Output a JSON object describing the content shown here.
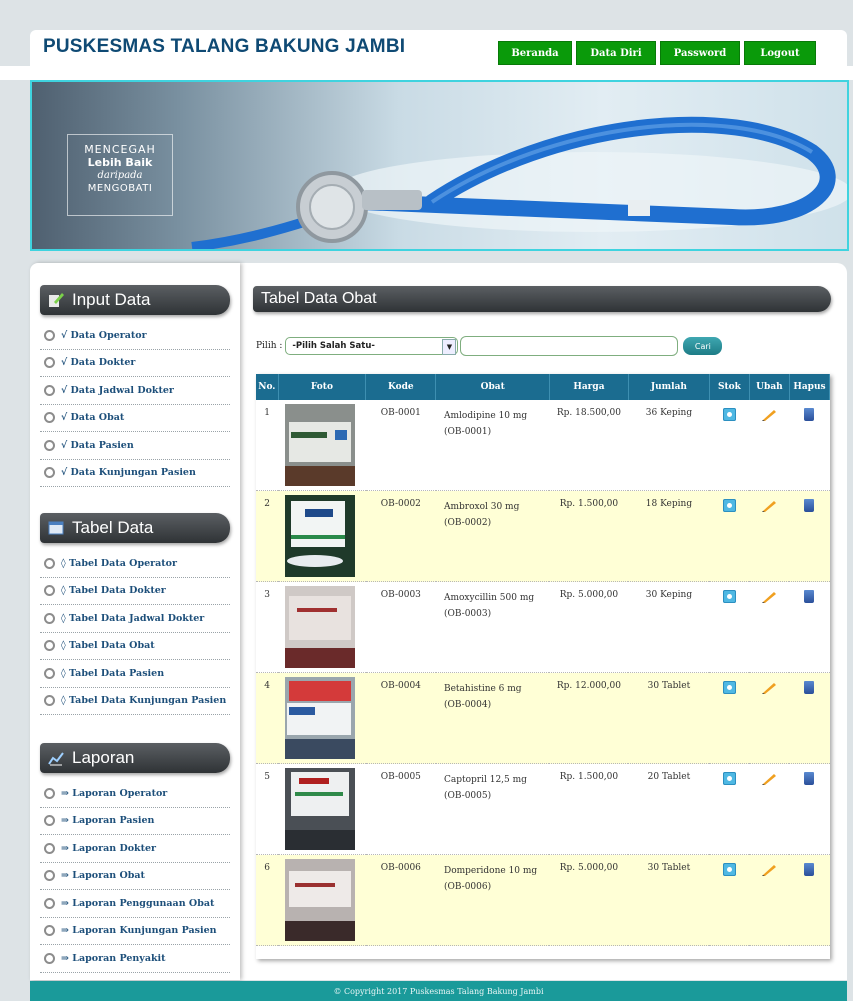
{
  "header": {
    "title": "PUSKESMAS TALANG BAKUNG JAMBI",
    "nav": [
      "Beranda",
      "Data Diri",
      "Password",
      "Logout"
    ]
  },
  "banner": {
    "line1": "MENCEGAH",
    "line2": "Lebih Baik",
    "line3": "daripada",
    "line4": "MENGOBATI"
  },
  "sidebar": {
    "input": {
      "title": "Input Data",
      "icon": "pencil-icon",
      "items": [
        "√ Data Operator",
        "√ Data Dokter",
        "√ Data Jadwal Dokter",
        "√ Data Obat",
        "√ Data Pasien",
        "√ Data Kunjungan Pasien"
      ]
    },
    "tabel": {
      "title": "Tabel Data",
      "icon": "table-icon",
      "items": [
        "◊ Tabel Data Operator",
        "◊ Tabel Data Dokter",
        "◊ Tabel Data Jadwal Dokter",
        "◊ Tabel Data Obat",
        "◊ Tabel Data Pasien",
        "◊ Tabel Data Kunjungan Pasien"
      ]
    },
    "laporan": {
      "title": "Laporan",
      "icon": "chart-icon",
      "items": [
        "⇒ Laporan Operator",
        "⇒ Laporan Pasien",
        "⇒ Laporan Dokter",
        "⇒ Laporan Obat",
        "⇒ Laporan Penggunaan Obat",
        "⇒ Laporan Kunjungan Pasien",
        "⇒ Laporan Penyakit"
      ]
    }
  },
  "main": {
    "title": "Tabel Data Obat",
    "filter": {
      "label": "Pilih :",
      "select_value": "-Pilih Salah Satu-",
      "search_value": "",
      "button": "Cari"
    },
    "columns": [
      "No.",
      "Foto",
      "Kode",
      "Obat",
      "Harga",
      "Jumlah",
      "Stok",
      "Ubah",
      "Hapus"
    ],
    "rows": [
      {
        "no": "1",
        "kode": "OB-0001",
        "obat": "Amlodipine 10 mg",
        "obat_code": "(OB-0001)",
        "harga": "Rp. 18.500,00",
        "jumlah": "36 Keping"
      },
      {
        "no": "2",
        "kode": "OB-0002",
        "obat": "Ambroxol 30 mg",
        "obat_code": "(OB-0002)",
        "harga": "Rp. 1.500,00",
        "jumlah": "18 Keping"
      },
      {
        "no": "3",
        "kode": "OB-0003",
        "obat": "Amoxycillin 500 mg",
        "obat_code": "(OB-0003)",
        "harga": "Rp. 5.000,00",
        "jumlah": "30 Keping"
      },
      {
        "no": "4",
        "kode": "OB-0004",
        "obat": "Betahistine 6 mg",
        "obat_code": "(OB-0004)",
        "harga": "Rp. 12.000,00",
        "jumlah": "30 Tablet"
      },
      {
        "no": "5",
        "kode": "OB-0005",
        "obat": "Captopril 12,5 mg",
        "obat_code": "(OB-0005)",
        "harga": "Rp. 1.500,00",
        "jumlah": "20 Tablet"
      },
      {
        "no": "6",
        "kode": "OB-0006",
        "obat": "Domperidone 10 mg",
        "obat_code": "(OB-0006)",
        "harga": "Rp. 5.000,00",
        "jumlah": "30 Tablet"
      }
    ]
  },
  "footer": {
    "text": "© Copyright 2017 Puskesmas Talang Bakung Jambi"
  },
  "colors": {
    "nav": "#0a9a0a",
    "table_header": "#1b6c90",
    "row_alt": "#ffffd6",
    "footer": "#1a9a9a",
    "title": "#0f4a74"
  }
}
